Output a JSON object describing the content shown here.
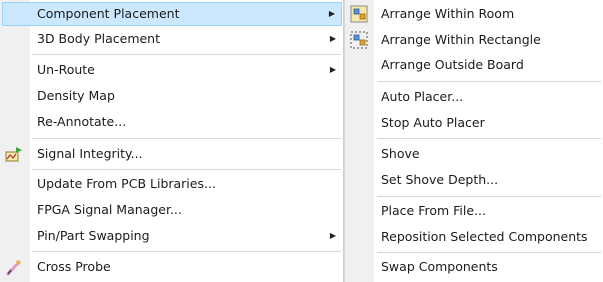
{
  "main_menu": {
    "component_placement": "Component Placement",
    "body_placement": "3D Body Placement",
    "un_route": "Un-Route",
    "density_map": "Density Map",
    "re_annotate": "Re-Annotate...",
    "signal_integrity": "Signal Integrity...",
    "update_from_pcb": "Update From PCB Libraries...",
    "fpga_signal_manager": "FPGA Signal Manager...",
    "pin_part_swapping": "Pin/Part Swapping",
    "cross_probe": "Cross Probe",
    "submenu_arrow": "▶"
  },
  "sub_menu": {
    "arrange_within_room": "Arrange Within Room",
    "arrange_within_rectangle": "Arrange Within Rectangle",
    "arrange_outside_board": "Arrange Outside Board",
    "auto_placer": "Auto Placer...",
    "stop_auto_placer": "Stop Auto Placer",
    "shove": "Shove",
    "set_shove_depth": "Set Shove Depth...",
    "place_from_file": "Place From File...",
    "reposition_selected": "Reposition Selected Components",
    "swap_components": "Swap Components"
  },
  "icons": {
    "signal_integrity": "signal-integrity-icon",
    "cross_probe": "cross-probe-icon",
    "arrange_within_room": "arrange-room-icon",
    "arrange_within_rectangle": "arrange-rectangle-icon"
  },
  "colors": {
    "highlight_fill": "#cce8ff",
    "highlight_border": "#99d1ff",
    "gutter": "#f0f0f0"
  }
}
